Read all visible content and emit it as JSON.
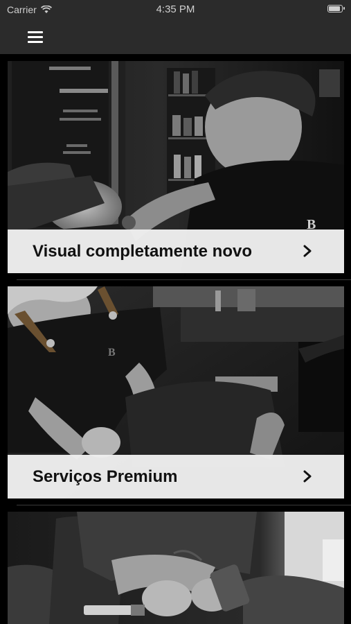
{
  "status_bar": {
    "carrier": "Carrier",
    "time": "4:35 PM"
  },
  "nav": {
    "menu_icon": "hamburger-menu-icon"
  },
  "cards": [
    {
      "title": "Visual completamente novo",
      "image": "photo of barber shaving a client with a towel over his eyes, shop window behind",
      "chevron_icon": "chevron-right-icon"
    },
    {
      "title": "Serviços Premium",
      "image": "photo of barber in apron working at a barber chair with grooming tools",
      "chevron_icon": "chevron-right-icon"
    },
    {
      "title": "",
      "image": "photo of tattooed barber holding hair clipper and cutting tools in a leather chair",
      "chevron_icon": ""
    }
  ],
  "colors": {
    "background": "#000000",
    "header": "#2b2b2b",
    "card_bar": "#eeeeee",
    "title_text": "#111111"
  }
}
